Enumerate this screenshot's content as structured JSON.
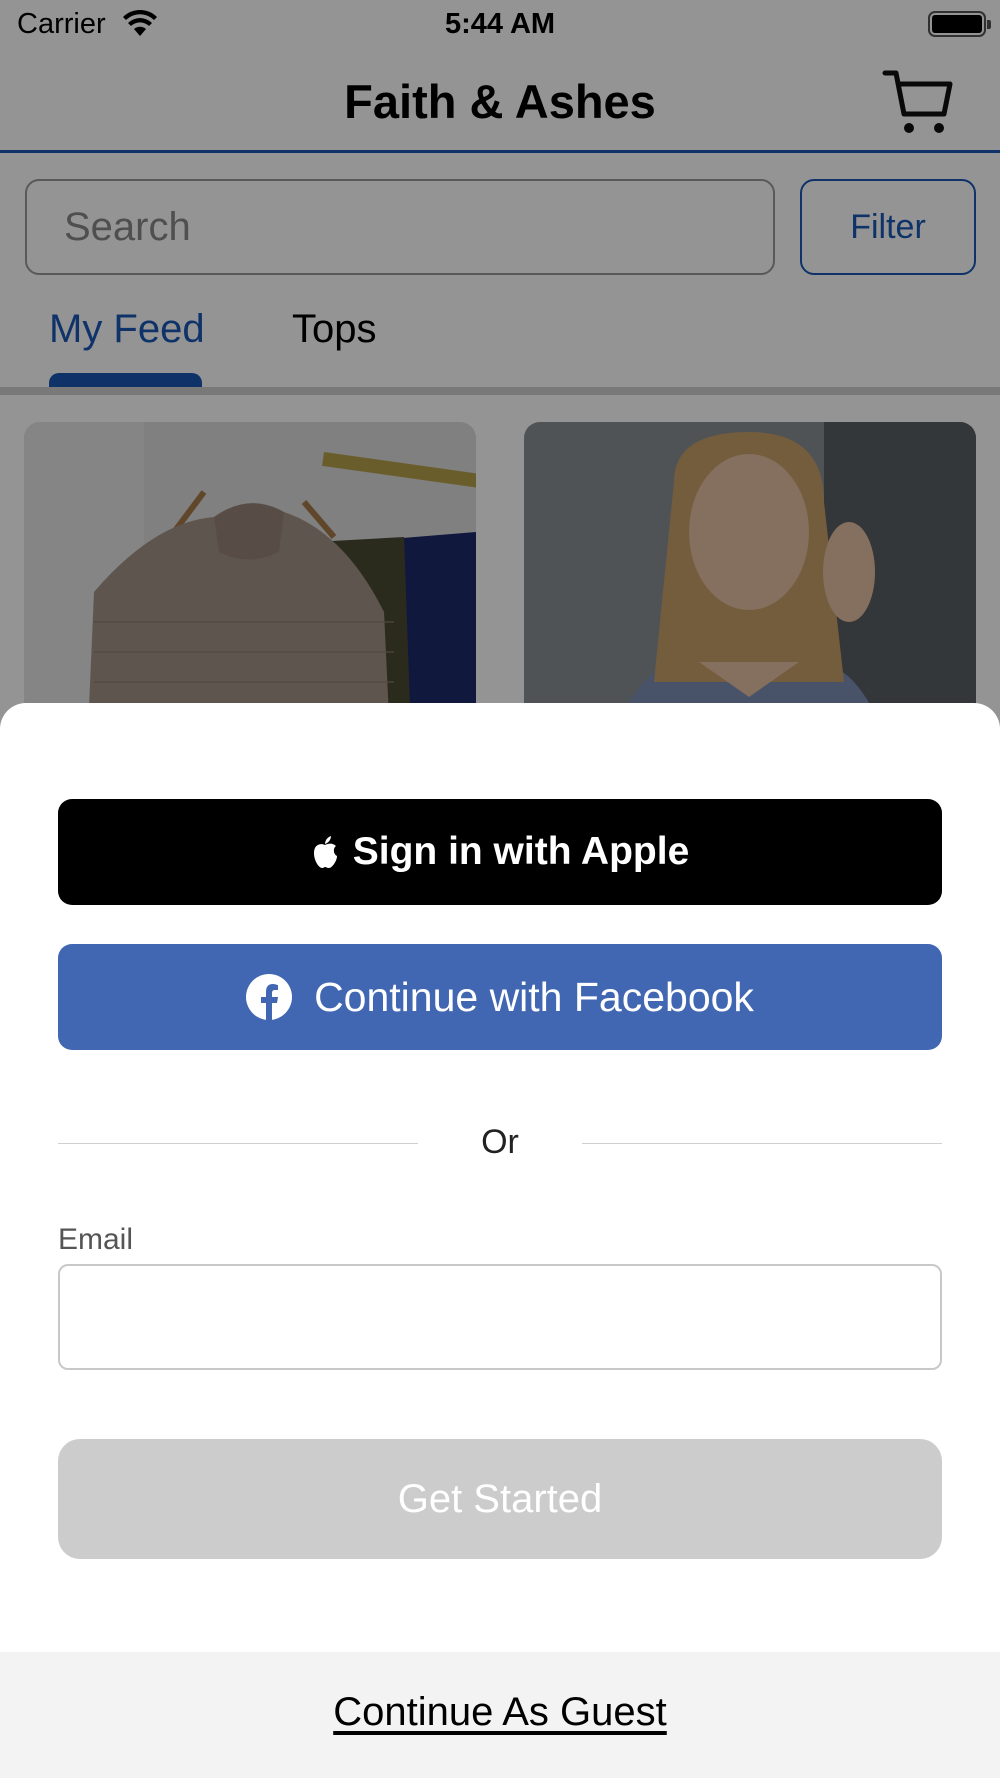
{
  "status_bar": {
    "carrier": "Carrier",
    "time": "5:44 AM",
    "icons": [
      "wifi-icon",
      "battery-icon"
    ]
  },
  "header": {
    "title": "Faith & Ashes",
    "cart_icon": "cart-icon",
    "accent_color": "#1b59b6"
  },
  "search": {
    "placeholder": "Search",
    "filter_label": "Filter"
  },
  "tabs": [
    {
      "label": "My Feed",
      "selected": true
    },
    {
      "label": "Tops",
      "selected": false
    }
  ],
  "products": [
    {
      "image": "striped-sweaters-on-rack"
    },
    {
      "image": "woman-in-blue-sweater"
    }
  ],
  "sheet": {
    "apple_label": "Sign in with Apple",
    "facebook_label": "Continue with Facebook",
    "facebook_color": "#4267b2",
    "divider_text": "Or",
    "email_label": "Email",
    "email_value": "",
    "get_started_label": "Get Started",
    "guest_label": "Continue As Guest"
  }
}
